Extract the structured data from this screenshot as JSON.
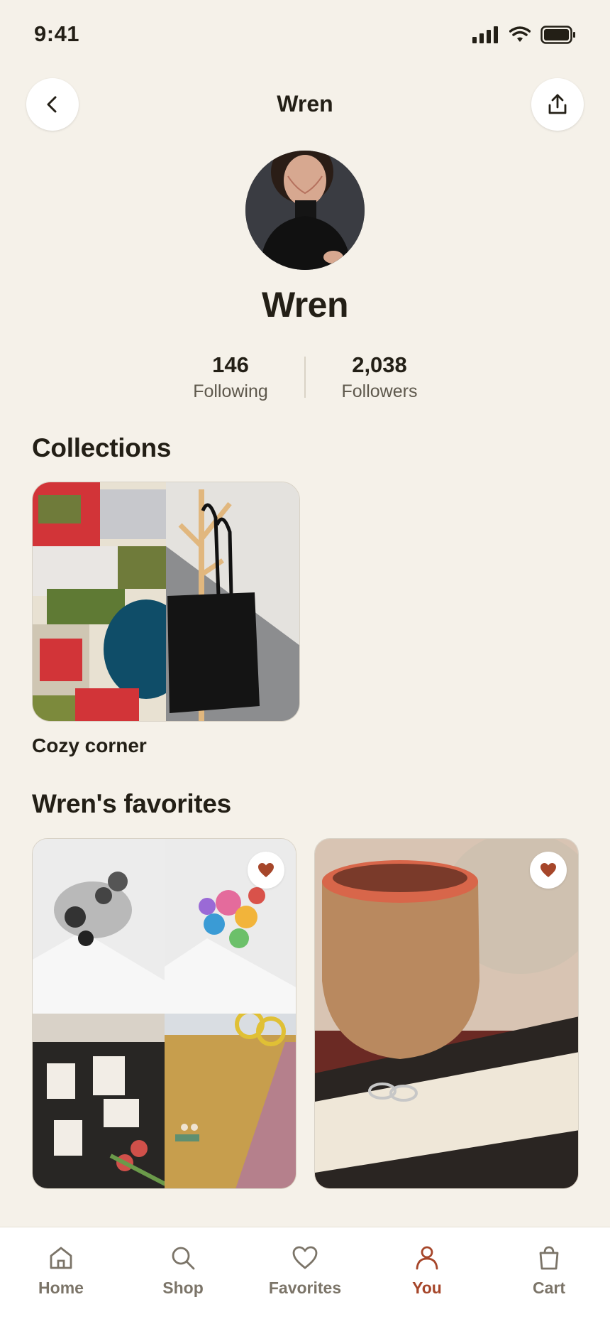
{
  "status_bar": {
    "time": "9:41"
  },
  "header": {
    "title": "Wren"
  },
  "profile": {
    "name": "Wren",
    "following_count": "146",
    "following_label": "Following",
    "followers_count": "2,038",
    "followers_label": "Followers"
  },
  "collections": {
    "title": "Collections",
    "items": [
      {
        "name": "Cozy corner"
      }
    ]
  },
  "favorites": {
    "title": "Wren's favorites"
  },
  "tab_bar": {
    "tabs": [
      {
        "label": "Home",
        "icon": "home-icon"
      },
      {
        "label": "Shop",
        "icon": "search-icon"
      },
      {
        "label": "Favorites",
        "icon": "heart-icon"
      },
      {
        "label": "You",
        "icon": "person-icon",
        "active": true
      },
      {
        "label": "Cart",
        "icon": "bag-icon"
      }
    ]
  },
  "colors": {
    "background": "#f5f1e9",
    "accent": "#a6462a",
    "text": "#231f16"
  }
}
